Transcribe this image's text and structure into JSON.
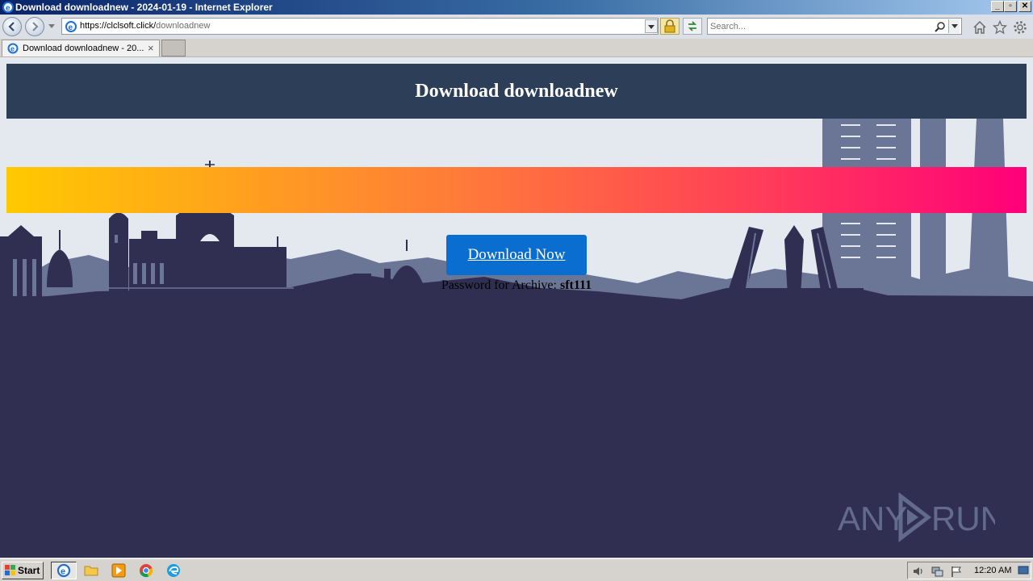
{
  "window": {
    "title": "Download downloadnew - 2024-01-19 - Internet Explorer",
    "controls": {
      "minimize": "_",
      "maximize": "▫",
      "close": "✕"
    }
  },
  "navbar": {
    "url_host": "https://clclsoft.click/",
    "url_path": "downloadnew",
    "search_placeholder": "Search..."
  },
  "tabs": [
    {
      "title": "Download downloadnew - 20...",
      "close": "×"
    }
  ],
  "page": {
    "heading": "Download downloadnew",
    "download_button": "Download Now",
    "password_label": "Password for Archive: ",
    "password_value": "sft111",
    "colors": {
      "header_bg": "#2d3e58",
      "button_bg": "#0a6ed1",
      "skyline_dark": "#302f52",
      "skyline_mid": "#6b7596",
      "gradient": [
        "#ffc900",
        "#ff7a3a",
        "#ff3a5a",
        "#ff007a"
      ]
    }
  },
  "watermark": {
    "text_left": "ANY",
    "text_right": "RUN"
  },
  "taskbar": {
    "start_label": "Start",
    "clock": "12:20 AM",
    "quick_launch": [
      "ie-icon",
      "folder-icon",
      "media-player-icon",
      "chrome-icon",
      "edge-icon"
    ]
  }
}
